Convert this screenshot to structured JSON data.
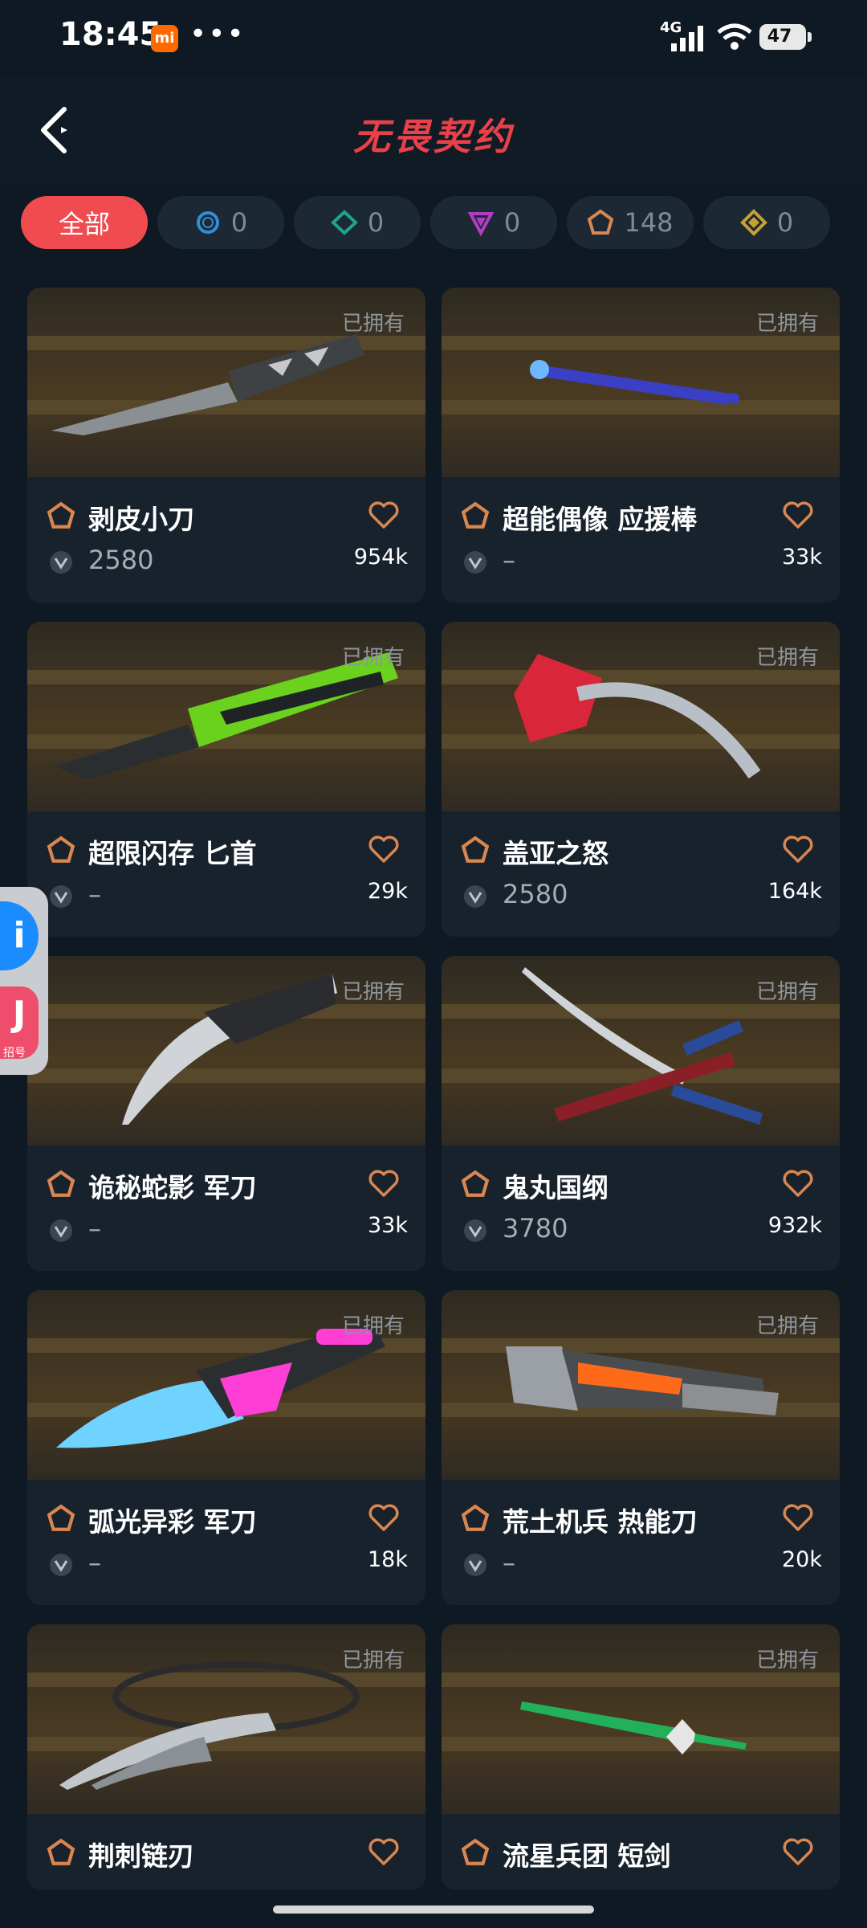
{
  "status": {
    "time": "18:45",
    "mi": "mi",
    "dots": "•••",
    "network": "4G",
    "battery": "47"
  },
  "header": {
    "title": "无畏契约"
  },
  "filters": [
    {
      "label": "全部",
      "active": true
    },
    {
      "count": "0",
      "tier": "select",
      "color": "#2f8fd8"
    },
    {
      "count": "0",
      "tier": "deluxe",
      "color": "#1aa58f"
    },
    {
      "count": "0",
      "tier": "premium",
      "color": "#b03dc4"
    },
    {
      "count": "148",
      "tier": "exclusive",
      "color": "#d98650"
    },
    {
      "count": "0",
      "tier": "ultra",
      "color": "#c5a233"
    }
  ],
  "owned_label": "已拥有",
  "items": [
    {
      "name": "剥皮小刀",
      "price": "2580",
      "likes": "954k"
    },
    {
      "name": "超能偶像 应援棒",
      "price": "–",
      "likes": "33k"
    },
    {
      "name": "超限闪存 匕首",
      "price": "–",
      "likes": "29k"
    },
    {
      "name": "盖亚之怒",
      "price": "2580",
      "likes": "164k"
    },
    {
      "name": "诡秘蛇影 军刀",
      "price": "–",
      "likes": "33k"
    },
    {
      "name": "鬼丸国纲",
      "price": "3780",
      "likes": "932k"
    },
    {
      "name": "弧光异彩 军刀",
      "price": "–",
      "likes": "18k"
    },
    {
      "name": "荒土机兵 热能刀",
      "price": "–",
      "likes": "20k"
    },
    {
      "name": "荆刺链刃",
      "price": "",
      "likes": ""
    },
    {
      "name": "流星兵团 短剑",
      "price": "",
      "likes": ""
    }
  ],
  "float_widget": {
    "top": "i",
    "bottom": "J",
    "label": "招号"
  },
  "colors": {
    "accent": "#f04c50",
    "tier_exclusive": "#d98650",
    "heart": "#d98650",
    "background": "#0f1923"
  }
}
